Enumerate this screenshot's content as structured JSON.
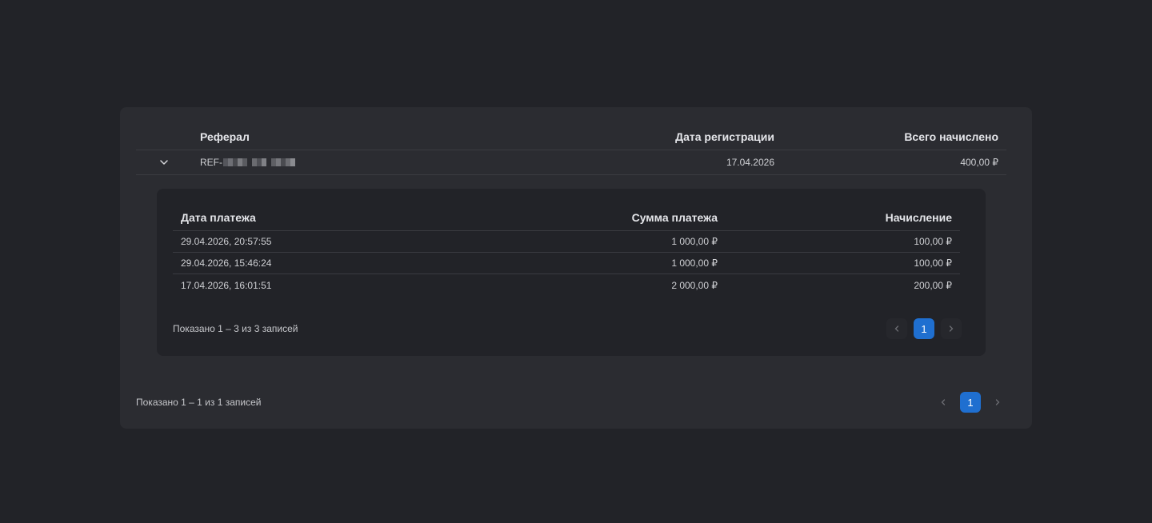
{
  "referrals": {
    "columns": {
      "referral": "Реферал",
      "registration_date": "Дата регистрации",
      "total_accrued": "Всего начислено"
    },
    "row": {
      "referral_prefix": "REF-",
      "registration_date": "17.04.2026",
      "total_accrued": "400,00 ₽"
    },
    "pagination": {
      "info": "Показано 1 – 1 из 1 записей",
      "current_page": "1",
      "prev_icon": "chevron-left-icon",
      "next_icon": "chevron-right-icon"
    }
  },
  "payments": {
    "columns": {
      "payment_date": "Дата платежа",
      "payment_amount": "Сумма платежа",
      "accrual": "Начисление"
    },
    "rows": [
      {
        "date": "29.04.2026, 20:57:55",
        "amount": "1 000,00 ₽",
        "accrual": "100,00 ₽"
      },
      {
        "date": "29.04.2026, 15:46:24",
        "amount": "1 000,00 ₽",
        "accrual": "100,00 ₽"
      },
      {
        "date": "17.04.2026, 16:01:51",
        "amount": "2 000,00 ₽",
        "accrual": "200,00 ₽"
      }
    ],
    "pagination": {
      "info": "Показано 1 – 3 из 3 записей",
      "current_page": "1"
    }
  },
  "colors": {
    "background": "#222328",
    "card": "#2b2c31",
    "accent": "#1f6fd0"
  }
}
